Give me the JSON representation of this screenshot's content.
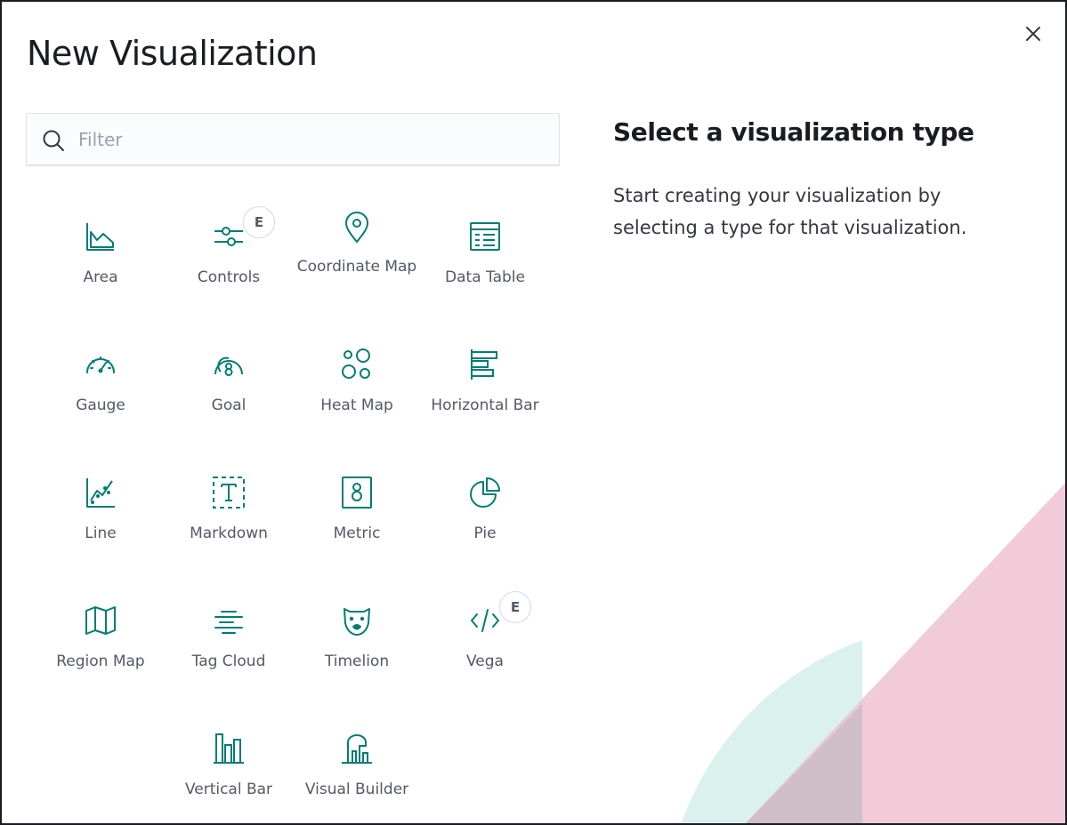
{
  "modal": {
    "title": "New Visualization",
    "close_icon": "close-icon"
  },
  "filter": {
    "placeholder": "Filter",
    "value": "",
    "icon": "search-icon"
  },
  "visualizations": [
    {
      "label": "Area",
      "icon": "area-chart-icon",
      "badge": ""
    },
    {
      "label": "Controls",
      "icon": "controls-icon",
      "badge": "E"
    },
    {
      "label": "Coordinate Map",
      "icon": "map-marker-icon",
      "badge": ""
    },
    {
      "label": "Data Table",
      "icon": "data-table-icon",
      "badge": ""
    },
    {
      "label": "Gauge",
      "icon": "gauge-icon",
      "badge": ""
    },
    {
      "label": "Goal",
      "icon": "goal-icon",
      "badge": ""
    },
    {
      "label": "Heat Map",
      "icon": "heat-map-icon",
      "badge": ""
    },
    {
      "label": "Horizontal Bar",
      "icon": "horizontal-bar-icon",
      "badge": ""
    },
    {
      "label": "Line",
      "icon": "line-chart-icon",
      "badge": ""
    },
    {
      "label": "Markdown",
      "icon": "markdown-icon",
      "badge": ""
    },
    {
      "label": "Metric",
      "icon": "metric-icon",
      "badge": ""
    },
    {
      "label": "Pie",
      "icon": "pie-chart-icon",
      "badge": ""
    },
    {
      "label": "Region Map",
      "icon": "region-map-icon",
      "badge": ""
    },
    {
      "label": "Tag Cloud",
      "icon": "tag-cloud-icon",
      "badge": ""
    },
    {
      "label": "Timelion",
      "icon": "timelion-icon",
      "badge": ""
    },
    {
      "label": "Vega",
      "icon": "code-icon",
      "badge": "E"
    },
    {
      "label": "Vertical Bar",
      "icon": "vertical-bar-icon",
      "badge": ""
    },
    {
      "label": "Visual Builder",
      "icon": "visual-builder-icon",
      "badge": ""
    }
  ],
  "side_panel": {
    "title": "Select a visualization type",
    "description": "Start creating your visualization by selecting a type for that visualization."
  },
  "colors": {
    "icon_accent": "#017d73",
    "text_primary": "#1a1c21",
    "text_label": "#535966",
    "deco_teal": "#d6efec",
    "deco_pink": "#f3c9d6"
  }
}
